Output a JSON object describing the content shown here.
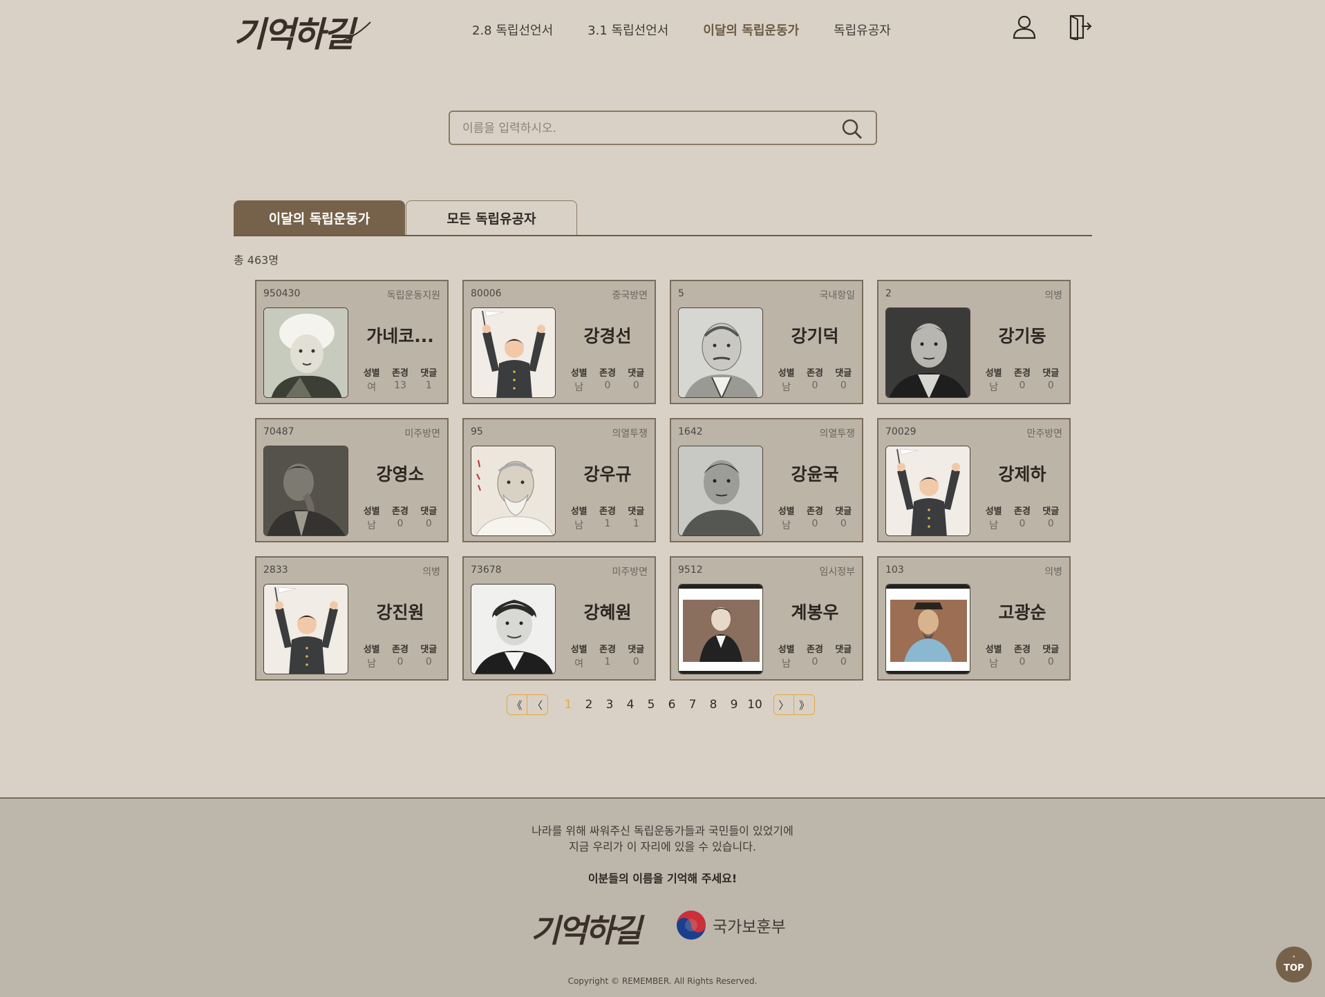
{
  "header": {
    "logo": "기억하길",
    "nav": [
      {
        "label": "2.8 독립선언서",
        "active": false
      },
      {
        "label": "3.1 독립선언서",
        "active": false
      },
      {
        "label": "이달의 독립운동가",
        "active": true
      },
      {
        "label": "독립유공자",
        "active": false
      }
    ],
    "icons": [
      "user-icon",
      "logout-icon"
    ]
  },
  "search": {
    "placeholder": "이름을 입력하시오.",
    "value": "",
    "icon": "search-icon"
  },
  "tabs": [
    {
      "label": "이달의 독립운동가",
      "active": true
    },
    {
      "label": "모든 독립유공자",
      "active": false
    }
  ],
  "total": "총 463명",
  "stat_labels": {
    "gender": "성별",
    "respect": "존경",
    "comment": "댓글"
  },
  "cards": [
    {
      "id": "950430",
      "category": "독립운동지원",
      "name": "가네코...",
      "gender": "여",
      "respect": "13",
      "comments": "1",
      "photo": "woman-headscarf"
    },
    {
      "id": "80006",
      "category": "중국방면",
      "name": "강경선",
      "gender": "남",
      "respect": "0",
      "comments": "0",
      "photo": "placeholder"
    },
    {
      "id": "5",
      "category": "국내항일",
      "name": "강기덕",
      "gender": "남",
      "respect": "0",
      "comments": "0",
      "photo": "sketch"
    },
    {
      "id": "2",
      "category": "의병",
      "name": "강기동",
      "gender": "남",
      "respect": "0",
      "comments": "0",
      "photo": "portrait-dark"
    },
    {
      "id": "70487",
      "category": "미주방면",
      "name": "강영소",
      "gender": "남",
      "respect": "0",
      "comments": "0",
      "photo": "portrait-dim"
    },
    {
      "id": "95",
      "category": "의열투쟁",
      "name": "강우규",
      "gender": "남",
      "respect": "1",
      "comments": "1",
      "photo": "elder"
    },
    {
      "id": "1642",
      "category": "의열투쟁",
      "name": "강윤국",
      "gender": "남",
      "respect": "0",
      "comments": "0",
      "photo": "portrait-gray"
    },
    {
      "id": "70029",
      "category": "만주방면",
      "name": "강제하",
      "gender": "남",
      "respect": "0",
      "comments": "0",
      "photo": "placeholder"
    },
    {
      "id": "2833",
      "category": "의병",
      "name": "강진원",
      "gender": "남",
      "respect": "0",
      "comments": "0",
      "photo": "placeholder"
    },
    {
      "id": "73678",
      "category": "미주방면",
      "name": "강혜원",
      "gender": "여",
      "respect": "1",
      "comments": "0",
      "photo": "woman-bw"
    },
    {
      "id": "9512",
      "category": "임시정부",
      "name": "계봉우",
      "gender": "남",
      "respect": "0",
      "comments": "0",
      "photo": "framed-suit"
    },
    {
      "id": "103",
      "category": "의병",
      "name": "고광순",
      "gender": "남",
      "respect": "0",
      "comments": "0",
      "photo": "framed-painting"
    }
  ],
  "pagination": {
    "first": "《",
    "prev": "〈",
    "next": "〉",
    "last": "》",
    "pages": [
      "1",
      "2",
      "3",
      "4",
      "5",
      "6",
      "7",
      "8",
      "9",
      "10"
    ],
    "current": "1"
  },
  "footer": {
    "line1": "나라를 위해 싸워주신 독립운동가들과 국민들이 있었기에",
    "line2": "지금 우리가 이 자리에 있을 수 있습니다.",
    "emphasis": "이분들의 이름을 기억해 주세요!",
    "logo": "기억하길",
    "partner": "국가보훈부",
    "copyright": "Copyright © REMEMBER. All Rights Reserved."
  },
  "top_button": {
    "arrow": "˄",
    "label": "TOP"
  },
  "colors": {
    "background": "#d9d1c5",
    "accent": "#76624a",
    "card": "#bdb4a8",
    "pager": "#e8a83c"
  }
}
